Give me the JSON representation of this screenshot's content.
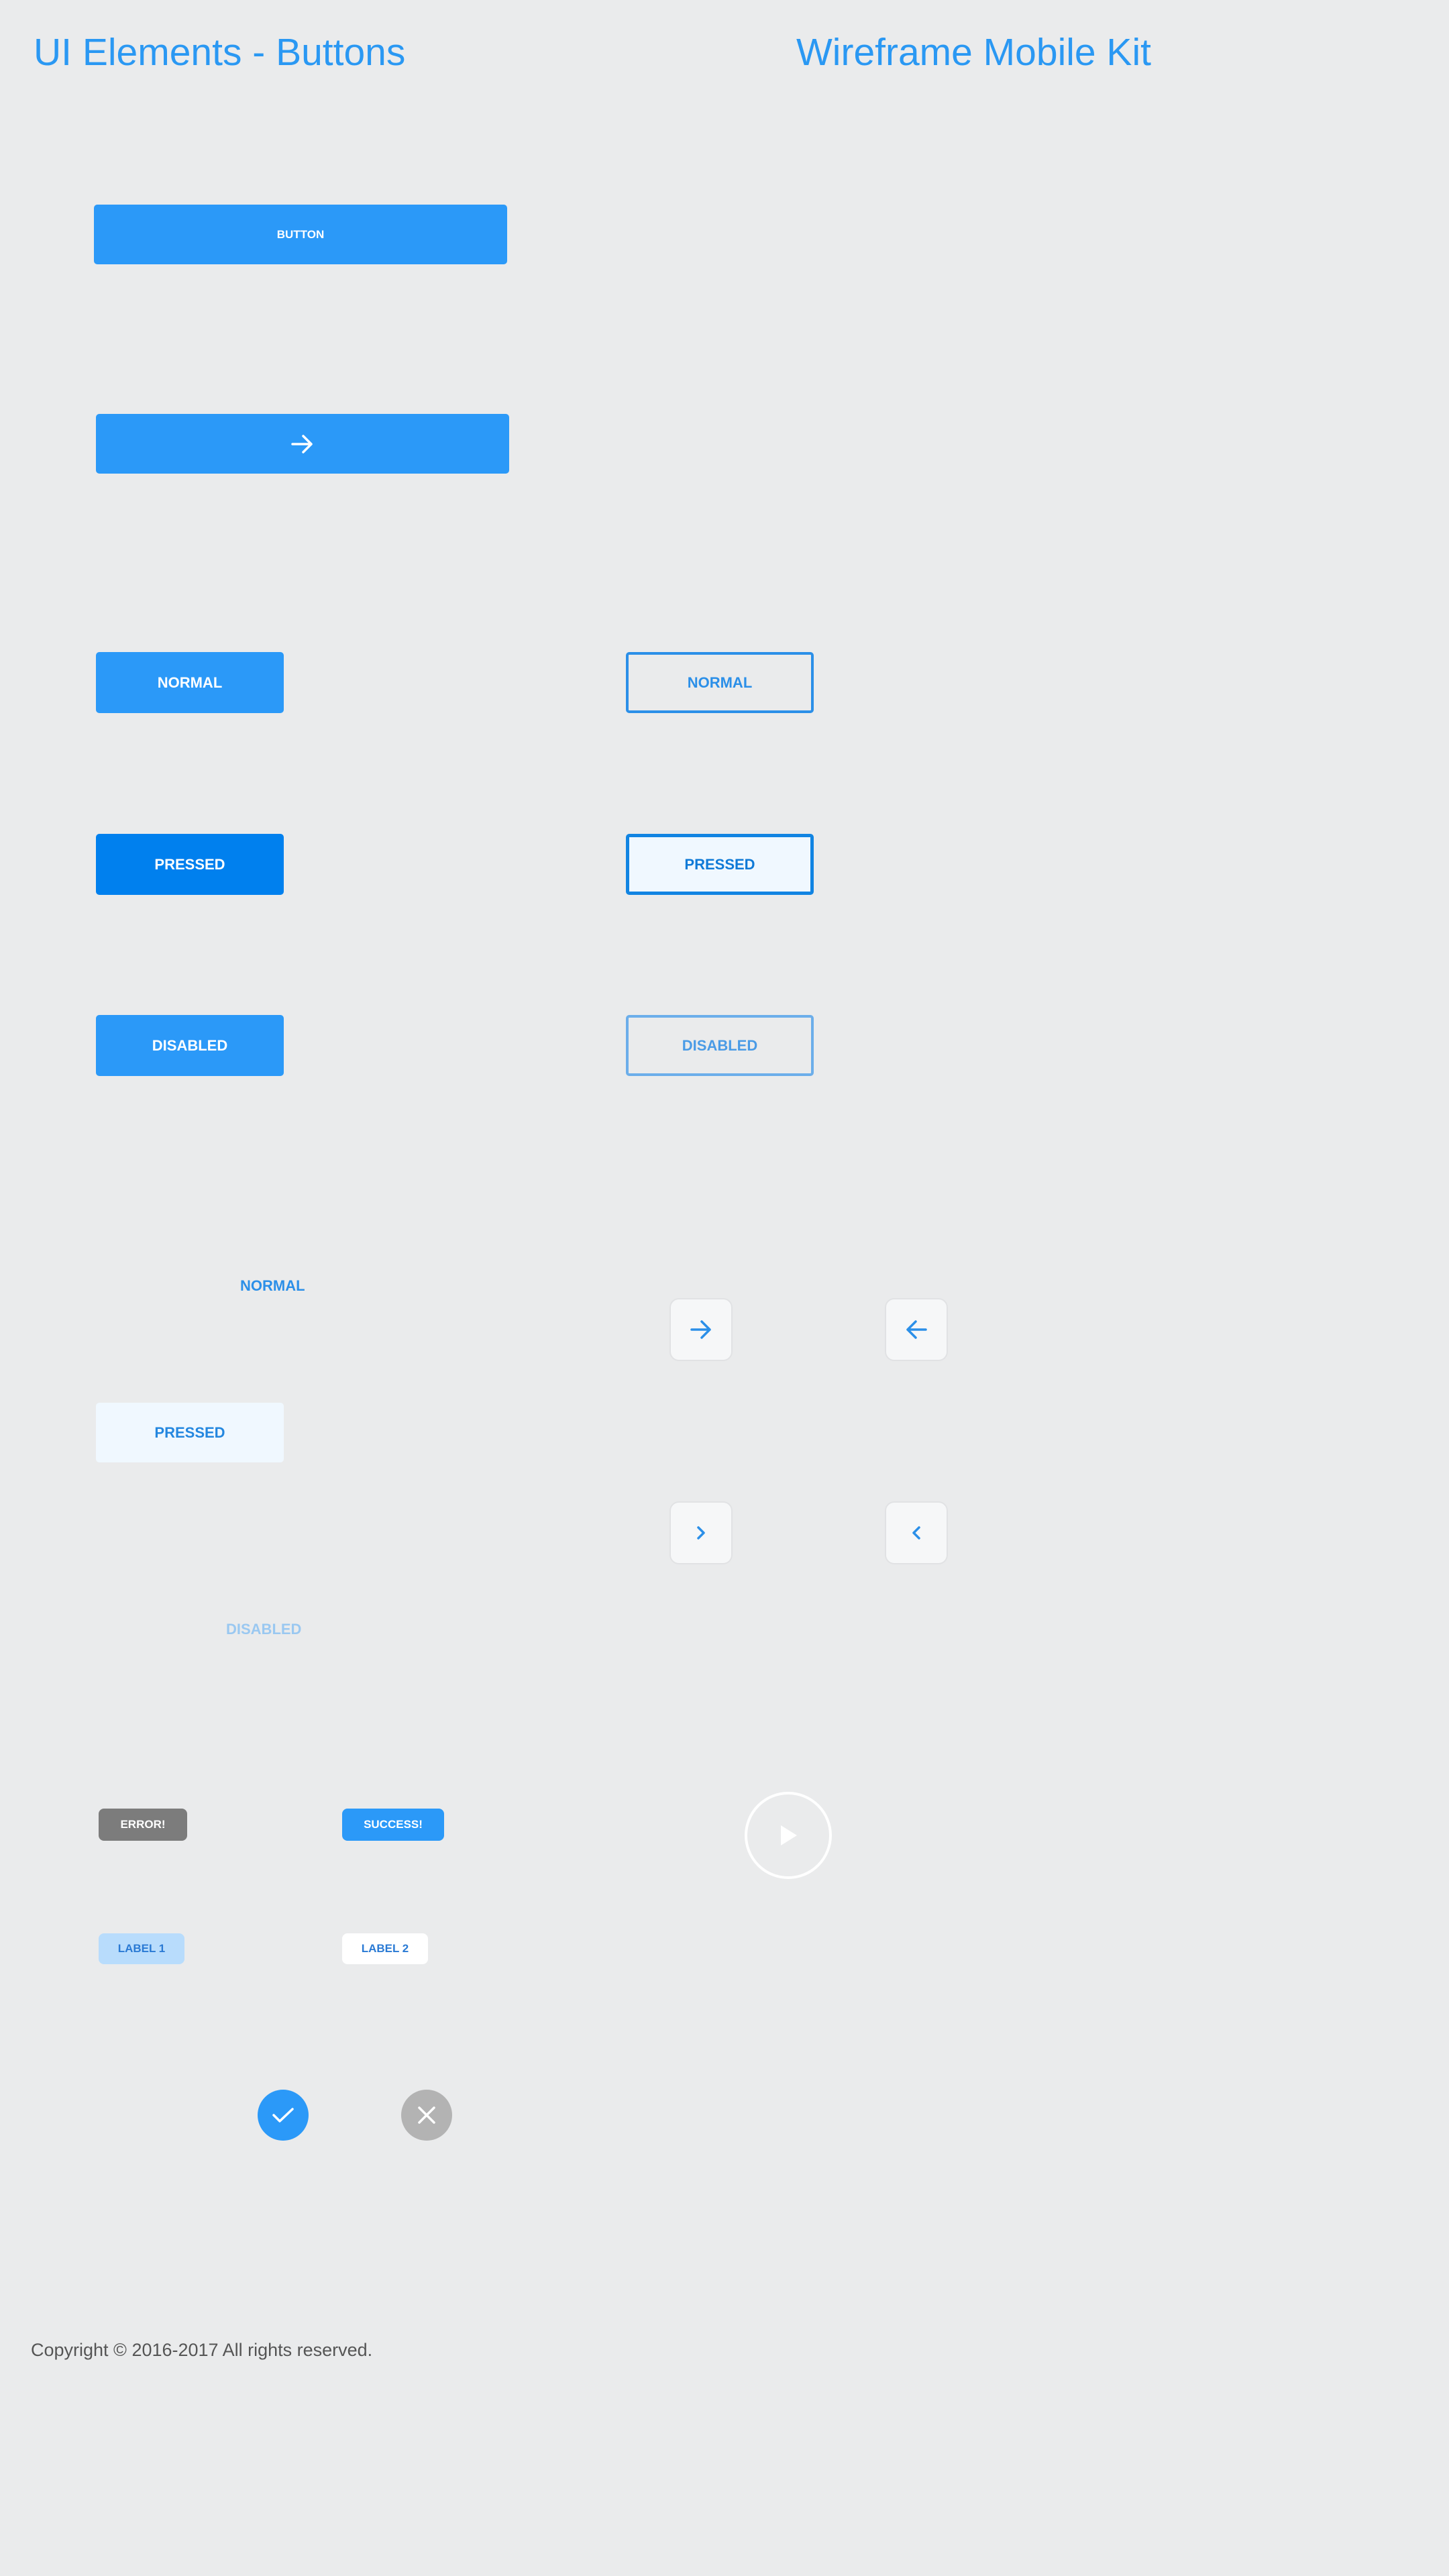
{
  "header": {
    "title_left": "UI Elements - Buttons",
    "title_right": "Wireframe Mobile Kit"
  },
  "buttons": {
    "primary_label": "BUTTON",
    "arrow_button_icon": "arrow-right-icon"
  },
  "filled_states": {
    "normal": "NORMAL",
    "pressed": "PRESSED",
    "disabled": "DISABLED"
  },
  "outline_states": {
    "normal": "NORMAL",
    "pressed": "PRESSED",
    "disabled": "DISABLED"
  },
  "text_states": {
    "normal": "NORMAL",
    "pressed": "PRESSED",
    "disabled": "DISABLED"
  },
  "icon_buttons": [
    "arrow-right-icon",
    "arrow-left-icon",
    "chevron-right-icon",
    "chevron-left-icon"
  ],
  "tags": {
    "error": "ERROR!",
    "success": "SUCCESS!",
    "label1": "LABEL 1",
    "label2": "LABEL 2"
  },
  "round_buttons": [
    "play-icon",
    "check-icon",
    "close-icon"
  ],
  "colors": {
    "background": "#eaebec",
    "primary": "#2b99f8",
    "primary_pressed": "#0080ee",
    "title": "#2a98f3",
    "error_gray": "#7c7c7c",
    "close_gray": "#b3b3b3"
  },
  "footer": {
    "copyright": "Copyright © 2016-2017 All rights reserved."
  }
}
